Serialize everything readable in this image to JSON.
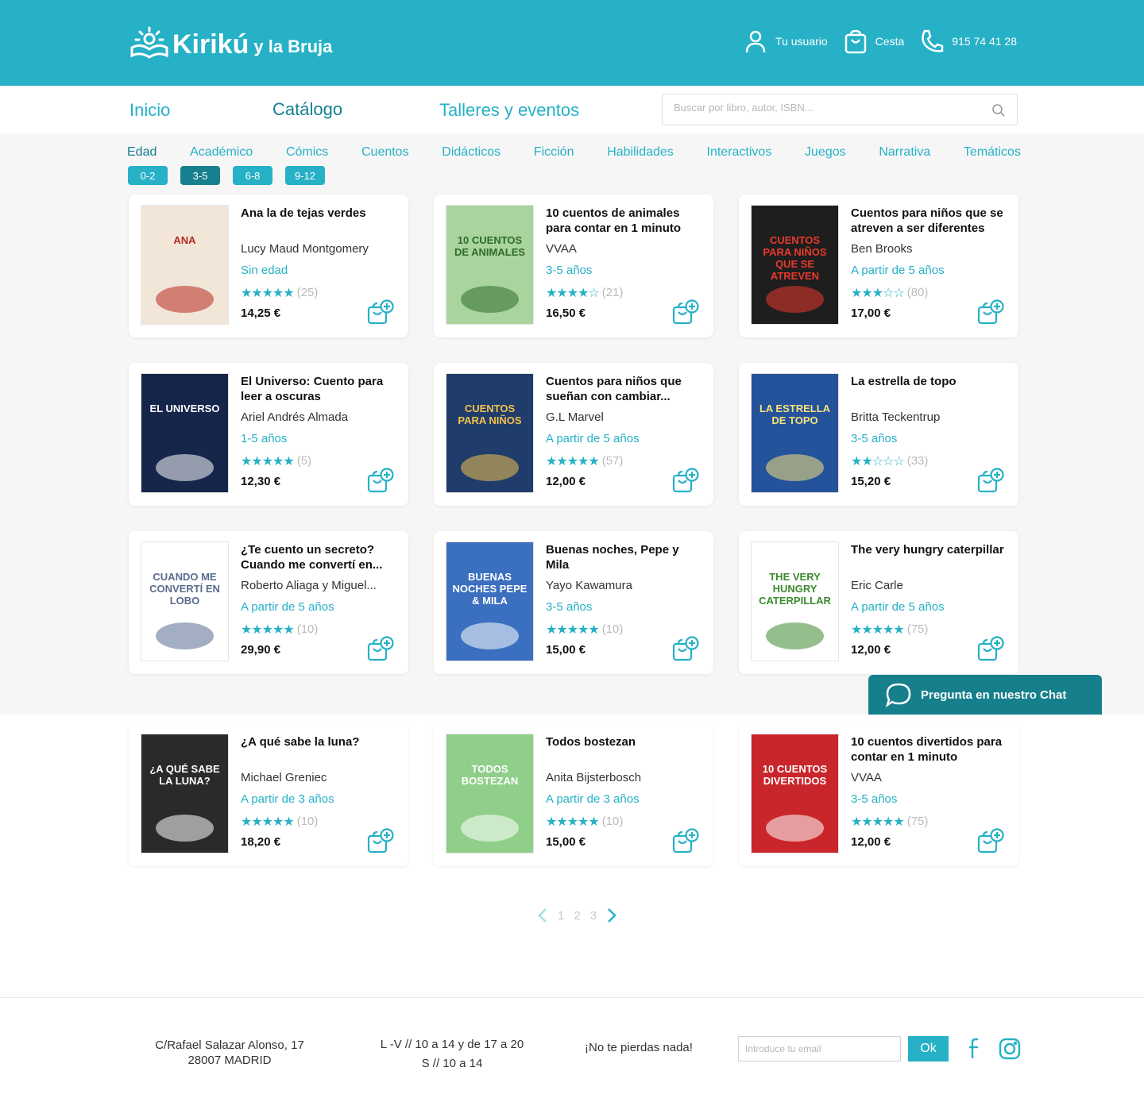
{
  "header": {
    "brand_main": "Kirikú",
    "brand_sub": "y la Bruja",
    "user_label": "Tu usuario",
    "cart_label": "Cesta",
    "phone": "915 74 41 28"
  },
  "nav": {
    "home": "Inicio",
    "catalog": "Catálogo",
    "events": "Talleres y eventos"
  },
  "search": {
    "placeholder": "Buscar por libro, autor, ISBN..."
  },
  "categories": [
    "Edad",
    "Académico",
    "Cómics",
    "Cuentos",
    "Didácticos",
    "Ficción",
    "Habilidades",
    "Interactivos",
    "Juegos",
    "Narrativa",
    "Temáticos"
  ],
  "age_filters": [
    "0-2",
    "3-5",
    "6-8",
    "9-12"
  ],
  "books": [
    {
      "title": "Ana la de tejas verdes",
      "author": "Lucy Maud Montgomery",
      "age": "Sin edad",
      "stars": "★★★★★",
      "reviews": "(25)",
      "price": "14,25 €",
      "cover_bg": "#f2e6d8",
      "cover_fg": "#b4291f",
      "cover_text": "Ana"
    },
    {
      "title": "10 cuentos de animales para contar en 1 minuto",
      "author": "VVAA",
      "age": "3-5 años",
      "stars": "★★★★☆",
      "reviews": "(21)",
      "price": "16,50 €",
      "cover_bg": "#a9d49e",
      "cover_fg": "#2f6b2a",
      "cover_text": "10 cuentos de animales"
    },
    {
      "title": "Cuentos para niños que se atreven a ser diferentes",
      "author": "Ben Brooks",
      "age": "A partir de 5 años",
      "stars": "★★★☆☆",
      "reviews": "(80)",
      "price": "17,00 €",
      "cover_bg": "#1e1e1e",
      "cover_fg": "#e8392b",
      "cover_text": "Cuentos para niños que se atreven"
    },
    {
      "title": "El Universo: Cuento para leer a oscuras",
      "author": "Ariel Andrés Almada",
      "age": "1-5 años",
      "stars": "★★★★★",
      "reviews": "(5)",
      "price": "12,30 €",
      "cover_bg": "#16254a",
      "cover_fg": "#ffffff",
      "cover_text": "El universo"
    },
    {
      "title": "Cuentos para niños que sueñan con cambiar...",
      "author": "G.L Marvel",
      "age": "A partir de 5 años",
      "stars": "★★★★★",
      "reviews": "(57)",
      "price": "12,00 €",
      "cover_bg": "#203c6b",
      "cover_fg": "#f2c14e",
      "cover_text": "Cuentos para niños"
    },
    {
      "title": "La estrella de topo",
      "author": " Britta Teckentrup",
      "age": "3-5 años",
      "stars": "★★☆☆☆",
      "reviews": "(33)",
      "price": "15,20 €",
      "cover_bg": "#24539c",
      "cover_fg": "#f6e27a",
      "cover_text": "La estrella de Topo"
    },
    {
      "title": "¿Te cuento un secreto? Cuando me convertí en...",
      "author": "Roberto Aliaga y Miguel...",
      "age": "A partir de 5 años",
      "stars": "★★★★★",
      "reviews": "(10)",
      "price": "29,90 €",
      "cover_bg": "#ffffff",
      "cover_fg": "#5a6c8f",
      "cover_text": "Cuando me convertí en lobo"
    },
    {
      "title": "Buenas noches, Pepe y Mila",
      "author": "Yayo Kawamura",
      "age": "3-5 años",
      "stars": "★★★★★",
      "reviews": "(10)",
      "price": "15,00 €",
      "cover_bg": "#3b6fbf",
      "cover_fg": "#ffffff",
      "cover_text": "Buenas noches Pepe & Mila"
    },
    {
      "title": "The very hungry caterpillar",
      "author": "Eric Carle",
      "age": "A partir de 5 años",
      "stars": "★★★★★",
      "reviews": "(75)",
      "price": "12,00 €",
      "cover_bg": "#ffffff",
      "cover_fg": "#3c8b2f",
      "cover_text": "The very hungry caterpillar"
    },
    {
      "title": "¿A qué sabe la luna?",
      "author": "Michael Greniec",
      "age": "A partir de 3 años",
      "stars": "★★★★★",
      "reviews": "(10)",
      "price": "18,20 €",
      "cover_bg": "#2a2a2a",
      "cover_fg": "#ffffff",
      "cover_text": "¿A qué sabe la luna?"
    },
    {
      "title": "Todos bostezan",
      "author": "Anita Bijsterbosch",
      "age": "A partir de 3 años",
      "stars": "★★★★★",
      "reviews": "(10)",
      "price": "15,00 €",
      "cover_bg": "#8fcf8a",
      "cover_fg": "#ffffff",
      "cover_text": "Todos bostezan"
    },
    {
      "title": "10 cuentos divertidos para contar en 1 minuto",
      "author": "VVAA",
      "age": "3-5 años",
      "stars": "★★★★★",
      "reviews": "(75)",
      "price": "12,00 €",
      "cover_bg": "#c9262b",
      "cover_fg": "#ffffff",
      "cover_text": "10 cuentos divertidos"
    }
  ],
  "chat": {
    "label": "Pregunta en nuestro Chat"
  },
  "pagination": {
    "pages": [
      "1",
      "2",
      "3"
    ]
  },
  "footer": {
    "address_line1": "C/Rafael Salazar Alonso, 17",
    "address_line2": "28007 MADRID",
    "hours_line1": "L -V // 10 a 14 y de 17 a 20",
    "hours_line2": "S // 10 a 14",
    "newsletter": "¡No te pierdas nada!",
    "email_placeholder": "Introduce tu email",
    "ok_label": "Ok"
  },
  "colors": {
    "accent": "#26b1c6",
    "accent_dark": "#16808f",
    "chat": "#167f8c",
    "background": "#f6f6f6"
  }
}
